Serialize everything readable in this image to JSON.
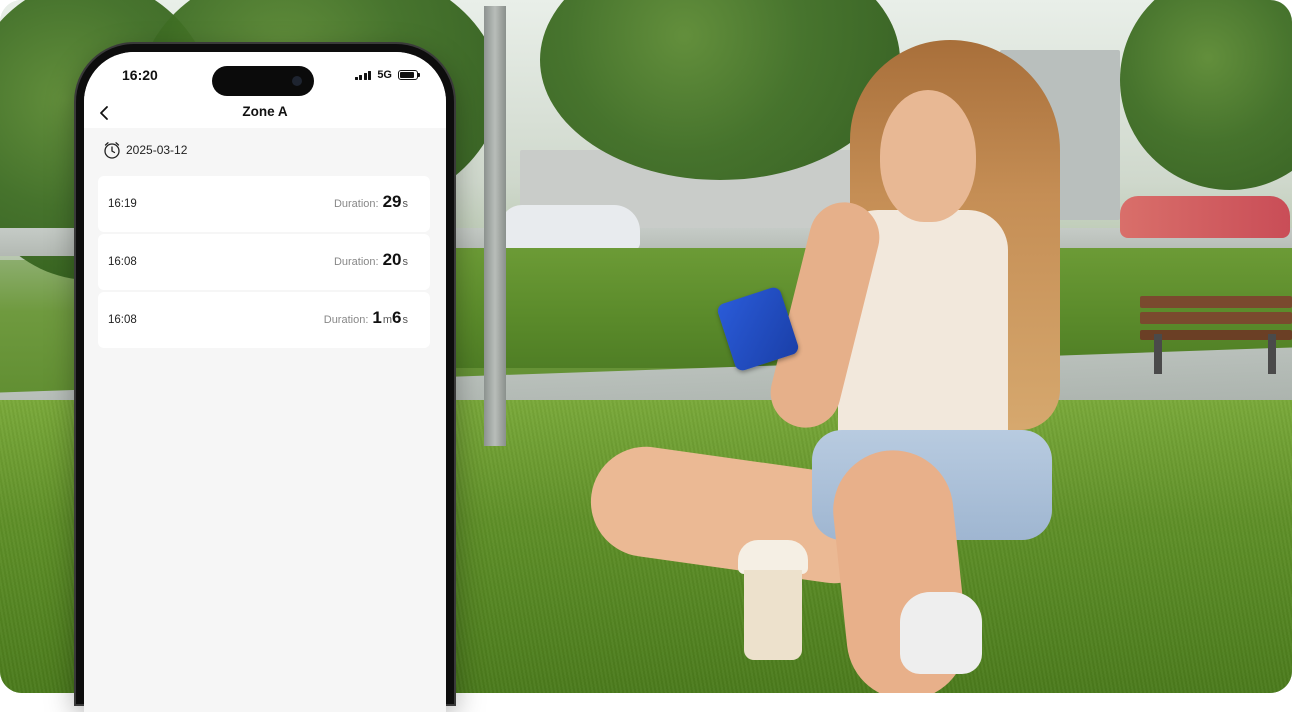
{
  "status_bar": {
    "time": "16:20",
    "network": "5G",
    "icons": [
      "signal-icon",
      "battery-icon"
    ]
  },
  "nav": {
    "back_icon": "chevron-left-icon",
    "title": "Zone A"
  },
  "date_row": {
    "icon": "alarm-clock-icon",
    "date": "2025-03-12"
  },
  "records": [
    {
      "time": "16:19",
      "label": "Duration:",
      "parts": [
        {
          "value": "29",
          "unit": "s"
        }
      ]
    },
    {
      "time": "16:08",
      "label": "Duration:",
      "parts": [
        {
          "value": "20",
          "unit": "s"
        }
      ]
    },
    {
      "time": "16:08",
      "label": "Duration:",
      "parts": [
        {
          "value": "1",
          "unit": "m"
        },
        {
          "value": "6",
          "unit": "s"
        }
      ]
    }
  ],
  "colors": {
    "screen_bg": "#f6f6f6",
    "card_bg": "#ffffff",
    "phone_body": "#0d0d0d",
    "background_phone": "#2a5bd8"
  }
}
